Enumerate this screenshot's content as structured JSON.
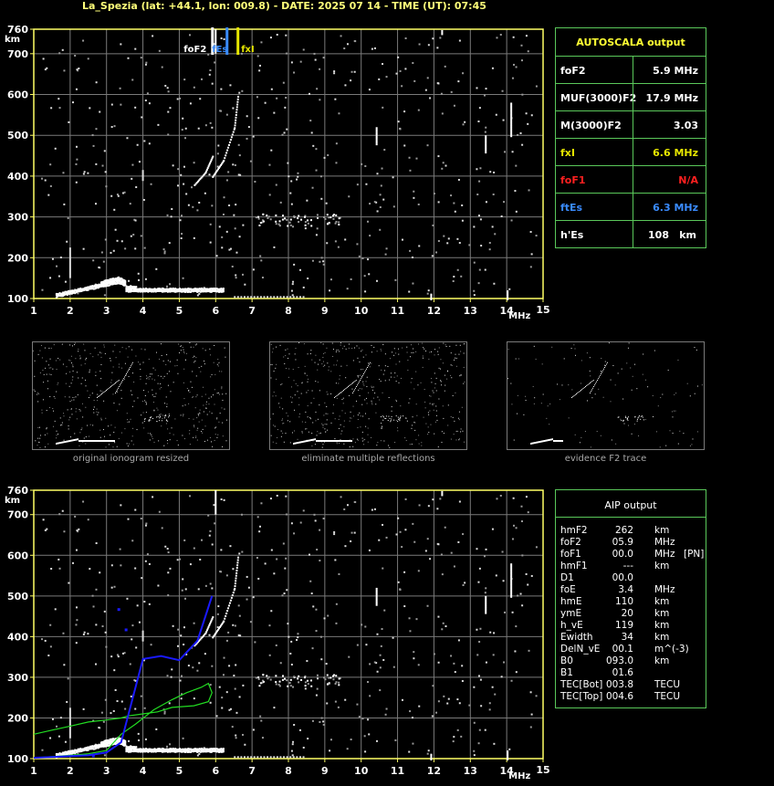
{
  "header": {
    "title": "La_Spezia (lat: +44.1, lon: 009.8) - DATE: 2025 07 14 - TIME (UT): 07:45"
  },
  "axes": {
    "y_unit": "km",
    "x_unit": "MHz",
    "y_ticks": [
      "100",
      "200",
      "300",
      "400",
      "500",
      "600",
      "700",
      "760"
    ],
    "x_ticks": [
      "1",
      "2",
      "3",
      "4",
      "5",
      "6",
      "7",
      "8",
      "9",
      "10",
      "11",
      "12",
      "13",
      "14",
      "15"
    ]
  },
  "markers": {
    "foF2_label": "foF2",
    "fEs_label": "fEs",
    "fxI_label": "fxI"
  },
  "autoscala": {
    "title": "AUTOSCALA output",
    "rows": [
      {
        "label": "foF2",
        "value": "5.9 MHz",
        "label_color": "#ffffff",
        "value_color": "#ffffff"
      },
      {
        "label": "MUF(3000)F2",
        "value": "17.9 MHz",
        "label_color": "#ffffff",
        "value_color": "#ffffff"
      },
      {
        "label": "M(3000)F2",
        "value": "3.03",
        "label_color": "#ffffff",
        "value_color": "#ffffff"
      },
      {
        "label": "fxI",
        "value": "6.6 MHz",
        "label_color": "#e6e600",
        "value_color": "#e6e600"
      },
      {
        "label": "foF1",
        "value": "N/A",
        "label_color": "#ff2020",
        "value_color": "#ff2020"
      },
      {
        "label": "ftEs",
        "value": "6.3 MHz",
        "label_color": "#3a8cff",
        "value_color": "#3a8cff"
      },
      {
        "label": "h'Es",
        "value": "108",
        "unit": "km",
        "label_color": "#ffffff",
        "value_color": "#ffffff"
      }
    ]
  },
  "thumbnails": {
    "captions": [
      "original ionogram resized",
      "eliminate multiple reflections",
      "evidence F2 trace"
    ]
  },
  "aip": {
    "title": "AIP output",
    "rows": [
      {
        "name": "hmF2",
        "value": "262",
        "unit": "km",
        "extra": ""
      },
      {
        "name": "foF2",
        "value": "05.9",
        "unit": "MHz",
        "extra": ""
      },
      {
        "name": "foF1",
        "value": "00.0",
        "unit": "MHz",
        "extra": "[PN]"
      },
      {
        "name": "hmF1",
        "value": "---",
        "unit": "km",
        "extra": ""
      },
      {
        "name": "D1",
        "value": "00.0",
        "unit": "",
        "extra": ""
      },
      {
        "name": "foE",
        "value": "3.4",
        "unit": "MHz",
        "extra": ""
      },
      {
        "name": "hmE",
        "value": "110",
        "unit": "km",
        "extra": ""
      },
      {
        "name": "ymE",
        "value": "20",
        "unit": "km",
        "extra": ""
      },
      {
        "name": "h_vE",
        "value": "119",
        "unit": "km",
        "extra": ""
      },
      {
        "name": "Ewidth",
        "value": "34",
        "unit": "km",
        "extra": ""
      },
      {
        "name": "DelN_vE",
        "value": "00.1",
        "unit": "m^(-3)",
        "extra": ""
      },
      {
        "name": "B0",
        "value": "093.0",
        "unit": "km",
        "extra": ""
      },
      {
        "name": "B1",
        "value": "01.6",
        "unit": "",
        "extra": ""
      },
      {
        "name": "TEC[Bot]",
        "value": "003.8",
        "unit": "TECU",
        "extra": ""
      },
      {
        "name": "TEC[Top]",
        "value": "004.6",
        "unit": "TECU",
        "extra": ""
      }
    ]
  },
  "colors": {
    "axis": "#ffff66",
    "grid": "#7a7a7a",
    "panel_border": "#5ac85a",
    "autoscala_title": "#ffff33",
    "aip_title": "#ffffff",
    "fEs_marker": "#3a8cff",
    "fxI_marker": "#e6e600",
    "foF2_marker": "#ffffff",
    "profile_green": "#22dd22",
    "trace_blue": "#1a1aff"
  },
  "chart_data": [
    {
      "type": "scatter",
      "title": "",
      "xlabel": "MHz",
      "ylabel": "km",
      "xlim": [
        1,
        15
      ],
      "ylim": [
        100,
        760
      ],
      "grid": true,
      "series": [
        {
          "values": [
            [
              1.7,
              105
            ],
            [
              2.2,
              110
            ],
            [
              2.6,
              113
            ],
            [
              3.0,
              125
            ],
            [
              3.3,
              145
            ],
            [
              3.6,
              125
            ],
            [
              4.0,
              120
            ],
            [
              5.0,
              118
            ],
            [
              6.0,
              118
            ]
          ]
        },
        {
          "values": [
            [
              5.4,
              380
            ],
            [
              5.7,
              410
            ],
            [
              5.9,
              450
            ]
          ]
        },
        {
          "values": [
            [
              5.9,
              400
            ],
            [
              6.2,
              440
            ],
            [
              6.5,
              520
            ],
            [
              6.6,
              600
            ]
          ]
        }
      ]
    },
    {
      "type": "line",
      "title": "",
      "xlabel": "MHz",
      "ylabel": "km",
      "xlim": [
        1,
        15
      ],
      "ylim": [
        100,
        760
      ],
      "grid": true,
      "series": [
        {
          "x": [
            1.0,
            1.5,
            2.0,
            2.5,
            3.0,
            3.4,
            3.8,
            4.3,
            4.8,
            5.2,
            5.6,
            5.8,
            5.9,
            5.8,
            5.4,
            4.8,
            4.4,
            4.0,
            3.6,
            3.4,
            3.0,
            2.5,
            2.0,
            1.5,
            1.0
          ],
          "y": [
            102,
            105,
            108,
            112,
            120,
            160,
            185,
            220,
            245,
            262,
            275,
            285,
            262,
            240,
            230,
            226,
            215,
            210,
            205,
            200,
            195,
            190,
            180,
            170,
            160
          ]
        },
        {
          "x": [
            1.0,
            1.5,
            2.0,
            2.5,
            3.0,
            3.4,
            4.0,
            4.5,
            5.0,
            5.5,
            5.9
          ],
          "y": [
            102,
            104,
            106,
            108,
            115,
            140,
            345,
            352,
            342,
            390,
            500
          ]
        }
      ]
    }
  ]
}
